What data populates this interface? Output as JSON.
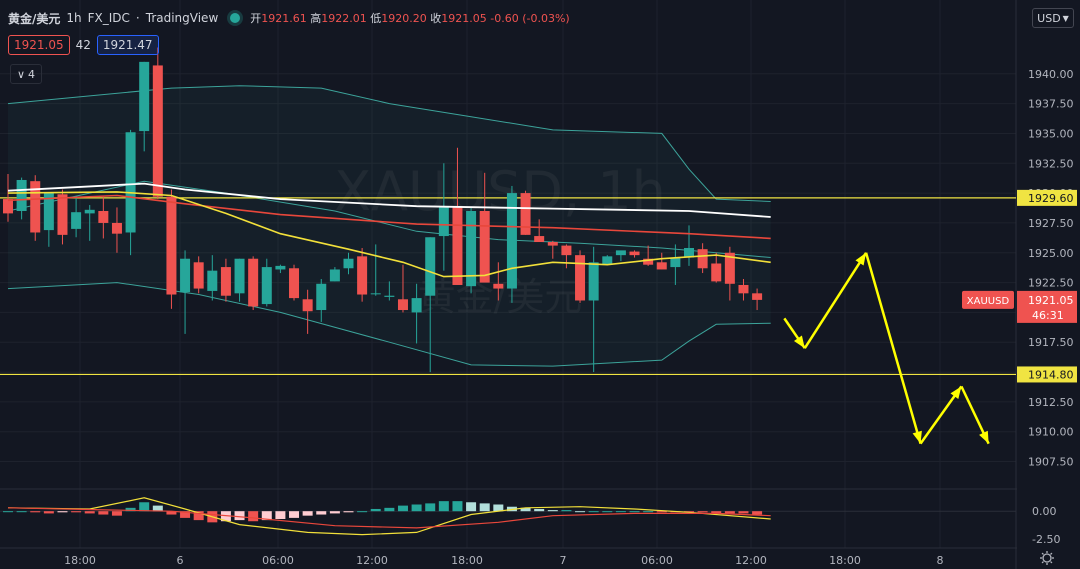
{
  "header": {
    "symbol": "黄金/美元",
    "interval": "1h",
    "source": "FX_IDC",
    "provider": "TradingView",
    "open_label": "开",
    "open": "1921.61",
    "high_label": "高",
    "high": "1922.01",
    "low_label": "低",
    "low": "1920.20",
    "close_label": "收",
    "close": "1921.05",
    "change": "-0.60 (-0.03%)"
  },
  "quote": {
    "bid": "1921.05",
    "spread": "42",
    "ask": "1921.47"
  },
  "indicator_toggle": "4",
  "currency_button": "USD",
  "watermark": {
    "symbol": "XAUUSD, 1h",
    "name": "黄金/美元"
  },
  "colors": {
    "background": "#131722",
    "up": "#26a69a",
    "down": "#ef5350",
    "level_line": "#f0e442",
    "arrow": "#ffff00",
    "ma_white": "#ffffff",
    "ma_red": "#e8473b",
    "ma_yellow": "#f2e03a",
    "bollinger": "#3ca39a"
  },
  "chart_data": {
    "type": "candlestick",
    "ylim": [
      1905.2,
      1943.0
    ],
    "y_ticks": [
      "1940.00",
      "1937.50",
      "1935.00",
      "1932.50",
      "1930.00",
      "1927.50",
      "1925.00",
      "1922.50",
      "1920.00",
      "1917.50",
      "1915.00",
      "1912.50",
      "1910.00",
      "1907.50"
    ],
    "x_ticks": [
      "18:00",
      "6",
      "06:00",
      "12:00",
      "18:00",
      "7",
      "06:00",
      "12:00",
      "18:00",
      "8"
    ],
    "candles": [
      [
        1929.5,
        1931.6,
        1927.6,
        1928.3
      ],
      [
        1928.5,
        1931.3,
        1927.8,
        1931.1
      ],
      [
        1931.0,
        1931.5,
        1926.0,
        1926.7
      ],
      [
        1926.9,
        1930.0,
        1925.5,
        1930.0
      ],
      [
        1929.9,
        1930.3,
        1925.7,
        1926.5
      ],
      [
        1927.0,
        1929.7,
        1926.3,
        1928.4
      ],
      [
        1928.3,
        1929.0,
        1926.0,
        1928.6
      ],
      [
        1928.5,
        1929.7,
        1926.2,
        1927.5
      ],
      [
        1927.5,
        1928.8,
        1925.0,
        1926.6
      ],
      [
        1926.7,
        1935.3,
        1924.8,
        1935.1
      ],
      [
        1935.2,
        1941.0,
        1933.5,
        1941.0
      ],
      [
        1940.7,
        1942.2,
        1929.5,
        1929.7
      ],
      [
        1929.7,
        1930.3,
        1920.3,
        1921.5
      ],
      [
        1921.7,
        1925.2,
        1918.2,
        1924.5
      ],
      [
        1924.2,
        1924.7,
        1921.6,
        1922.0
      ],
      [
        1921.8,
        1924.8,
        1921.0,
        1923.5
      ],
      [
        1923.8,
        1924.5,
        1920.9,
        1921.4
      ],
      [
        1921.6,
        1924.5,
        1920.9,
        1924.5
      ],
      [
        1924.5,
        1924.7,
        1920.2,
        1920.5
      ],
      [
        1920.7,
        1924.5,
        1920.5,
        1923.8
      ],
      [
        1923.6,
        1924.0,
        1923.3,
        1923.9
      ],
      [
        1923.7,
        1924.0,
        1921.0,
        1921.2
      ],
      [
        1921.1,
        1921.9,
        1918.2,
        1920.1
      ],
      [
        1920.2,
        1922.8,
        1919.2,
        1922.4
      ],
      [
        1922.6,
        1923.8,
        1922.6,
        1923.6
      ],
      [
        1923.7,
        1925.0,
        1923.2,
        1924.5
      ],
      [
        1924.7,
        1925.4,
        1920.9,
        1921.5
      ],
      [
        1921.6,
        1925.7,
        1921.4,
        1921.6
      ],
      [
        1921.3,
        1922.6,
        1921.0,
        1921.4
      ],
      [
        1921.1,
        1924.0,
        1920.0,
        1920.2
      ],
      [
        1920.0,
        1922.4,
        1917.4,
        1921.2
      ],
      [
        1921.4,
        1926.3,
        1915.0,
        1926.3
      ],
      [
        1926.4,
        1932.5,
        1923.5,
        1928.8
      ],
      [
        1928.8,
        1933.8,
        1928.2,
        1922.3
      ],
      [
        1922.2,
        1928.8,
        1921.6,
        1928.5
      ],
      [
        1928.5,
        1931.7,
        1925.5,
        1922.5
      ],
      [
        1922.4,
        1924.2,
        1921.0,
        1922.0
      ],
      [
        1922.0,
        1930.6,
        1920.8,
        1930.0
      ],
      [
        1930.0,
        1930.2,
        1926.5,
        1926.5
      ],
      [
        1926.4,
        1927.8,
        1926.2,
        1925.9
      ],
      [
        1925.9,
        1926.0,
        1924.5,
        1925.6
      ],
      [
        1925.6,
        1925.7,
        1923.7,
        1924.8
      ],
      [
        1924.8,
        1925.2,
        1920.8,
        1921.0
      ],
      [
        1921.0,
        1925.5,
        1915.0,
        1924.2
      ],
      [
        1924.0,
        1924.8,
        1924.0,
        1924.7
      ],
      [
        1924.8,
        1925.0,
        1924.3,
        1925.2
      ],
      [
        1925.1,
        1925.2,
        1924.6,
        1924.8
      ],
      [
        1924.5,
        1925.6,
        1923.9,
        1924.0
      ],
      [
        1924.2,
        1925.0,
        1923.6,
        1923.6
      ],
      [
        1923.8,
        1925.7,
        1922.3,
        1924.6
      ],
      [
        1924.6,
        1927.3,
        1923.9,
        1925.4
      ],
      [
        1925.3,
        1925.8,
        1923.3,
        1923.7
      ],
      [
        1924.1,
        1925.0,
        1922.5,
        1922.6
      ],
      [
        1925.0,
        1925.5,
        1921.0,
        1922.4
      ],
      [
        1922.3,
        1922.8,
        1921.0,
        1921.6
      ],
      [
        1921.6,
        1922.0,
        1920.2,
        1921.05
      ]
    ],
    "ma_white": [
      [
        0,
        1930.2
      ],
      [
        10,
        1930.8
      ],
      [
        13,
        1930.3
      ],
      [
        20,
        1929.5
      ],
      [
        30,
        1928.9
      ],
      [
        40,
        1928.7
      ],
      [
        50,
        1928.5
      ],
      [
        56,
        1928.0
      ]
    ],
    "ma_red": [
      [
        0,
        1929.4
      ],
      [
        8,
        1929.8
      ],
      [
        13,
        1929.1
      ],
      [
        20,
        1928.2
      ],
      [
        30,
        1927.4
      ],
      [
        40,
        1927.1
      ],
      [
        50,
        1926.6
      ],
      [
        56,
        1926.2
      ]
    ],
    "ma_yellow": [
      [
        0,
        1930.0
      ],
      [
        8,
        1930.1
      ],
      [
        12,
        1929.8
      ],
      [
        16,
        1928.3
      ],
      [
        20,
        1926.6
      ],
      [
        25,
        1925.3
      ],
      [
        29,
        1924.2
      ],
      [
        32,
        1923.0
      ],
      [
        35,
        1923.1
      ],
      [
        37,
        1923.7
      ],
      [
        40,
        1924.2
      ],
      [
        44,
        1924.0
      ],
      [
        48,
        1924.5
      ],
      [
        52,
        1924.8
      ],
      [
        56,
        1924.2
      ]
    ],
    "bb_upper": [
      [
        0,
        1937.5
      ],
      [
        12,
        1938.8
      ],
      [
        17,
        1939.0
      ],
      [
        23,
        1938.8
      ],
      [
        28,
        1937.5
      ],
      [
        34,
        1936.4
      ],
      [
        40,
        1935.3
      ],
      [
        48,
        1935.0
      ],
      [
        50,
        1932.0
      ],
      [
        52,
        1929.5
      ],
      [
        56,
        1929.3
      ]
    ],
    "bb_mid": [
      [
        0,
        1928.5
      ],
      [
        10,
        1931.0
      ],
      [
        16,
        1930.0
      ],
      [
        24,
        1928.5
      ],
      [
        30,
        1926.8
      ],
      [
        36,
        1926.1
      ],
      [
        42,
        1925.8
      ],
      [
        48,
        1925.4
      ],
      [
        56,
        1924.6
      ]
    ],
    "bb_lower": [
      [
        0,
        1922.0
      ],
      [
        8,
        1922.5
      ],
      [
        14,
        1921.5
      ],
      [
        20,
        1920.0
      ],
      [
        28,
        1917.5
      ],
      [
        34,
        1915.6
      ],
      [
        40,
        1915.5
      ],
      [
        48,
        1916.0
      ],
      [
        50,
        1917.6
      ],
      [
        52,
        1919.0
      ],
      [
        56,
        1919.1
      ]
    ],
    "levels": [
      {
        "label": "1929.60",
        "value": 1929.6
      },
      {
        "label": "1914.80",
        "value": 1914.8
      }
    ],
    "current_price": {
      "symbol": "XAUUSD",
      "price": "1921.05",
      "countdown": "46:31",
      "value": 1921.05
    },
    "forecast_path": [
      [
        57,
        1919.5
      ],
      [
        58.5,
        1917.0
      ],
      [
        63,
        1925.0
      ],
      [
        67,
        1909.0
      ],
      [
        70,
        1913.8
      ],
      [
        72,
        1909.0
      ]
    ],
    "macd": {
      "ylim": [
        -3.3,
        1.9
      ],
      "y_ticks": [
        "0.00",
        "-2.50"
      ],
      "histogram": [
        0.0,
        0.0,
        -0.1,
        -0.2,
        -0.1,
        -0.1,
        -0.2,
        -0.3,
        -0.4,
        0.3,
        0.8,
        0.5,
        -0.3,
        -0.6,
        -0.8,
        -1.0,
        -0.9,
        -0.8,
        -0.9,
        -0.8,
        -0.7,
        -0.6,
        -0.4,
        -0.3,
        -0.2,
        -0.1,
        0.0,
        0.2,
        0.3,
        0.5,
        0.6,
        0.7,
        0.9,
        0.9,
        0.8,
        0.7,
        0.6,
        0.4,
        0.3,
        0.2,
        0.1,
        0.1,
        0.0,
        0.0,
        0.0,
        0.0,
        0.0,
        0.0,
        -0.1,
        -0.1,
        -0.1,
        -0.1,
        -0.2,
        -0.2,
        -0.2,
        -0.3
      ],
      "macd_line": [
        [
          0,
          0.3
        ],
        [
          6,
          0.2
        ],
        [
          10,
          1.2
        ],
        [
          13,
          0.2
        ],
        [
          17,
          -1.2
        ],
        [
          22,
          -1.9
        ],
        [
          26,
          -2.1
        ],
        [
          30,
          -1.9
        ],
        [
          34,
          -0.3
        ],
        [
          38,
          0.3
        ],
        [
          42,
          0.4
        ],
        [
          46,
          0.2
        ],
        [
          50,
          -0.1
        ],
        [
          56,
          -0.7
        ]
      ],
      "signal_line": [
        [
          0,
          0.3
        ],
        [
          8,
          0.1
        ],
        [
          12,
          0.0
        ],
        [
          18,
          -0.6
        ],
        [
          24,
          -1.3
        ],
        [
          30,
          -1.5
        ],
        [
          36,
          -1.0
        ],
        [
          40,
          -0.4
        ],
        [
          46,
          -0.2
        ],
        [
          52,
          -0.2
        ],
        [
          56,
          -0.4
        ]
      ]
    }
  }
}
